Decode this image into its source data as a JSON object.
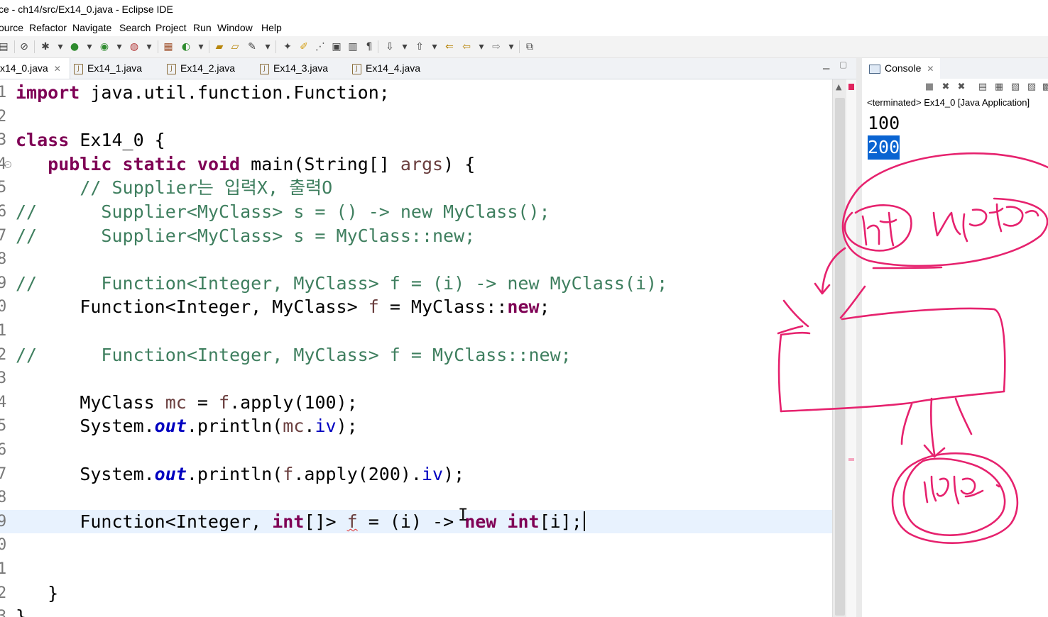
{
  "window": {
    "title": "ce - ch14/src/Ex14_0.java - Eclipse IDE"
  },
  "menu": [
    "ource",
    "Refactor",
    "Navigate",
    "Search",
    "Project",
    "Run",
    "Window",
    "Help"
  ],
  "editor": {
    "tabs": [
      {
        "label": "x14_0.java",
        "active": true,
        "closable": true
      },
      {
        "label": "Ex14_1.java"
      },
      {
        "label": "Ex14_2.java"
      },
      {
        "label": "Ex14_3.java"
      },
      {
        "label": "Ex14_4.java"
      }
    ],
    "line_numbers": [
      "1",
      "2",
      "3",
      "4",
      "5",
      "6",
      "7",
      "8",
      "9",
      "0",
      "1",
      "2",
      "3",
      "4",
      "5",
      "6",
      "7",
      "8",
      "9",
      "0",
      "1",
      "2",
      "3"
    ],
    "current_line_index": 18,
    "code": {
      "l1": {
        "kw": "import",
        "rest": " java.util.function.Function;"
      },
      "l3": {
        "kw": "class",
        "rest": " Ex14_0 {"
      },
      "l4": {
        "indent": "   ",
        "kw1": "public",
        "s1": " ",
        "kw2": "static",
        "s2": " ",
        "kw3": "void",
        "rest": " main(String[] ",
        "args": "args",
        "end": ") {"
      },
      "l5": {
        "indent": "      ",
        "comment": "// Supplier는 입력X, 출력O"
      },
      "l6": {
        "comment": "//      Supplier<MyClass> s = () -> new MyClass();"
      },
      "l7": {
        "comment": "//      Supplier<MyClass> s = MyClass::new;"
      },
      "l9": {
        "comment": "//      Function<Integer, MyClass> f = (i) -> new MyClass(i);"
      },
      "l10": {
        "indent": "      ",
        "a": "Function<Integer, MyClass> ",
        "f": "f",
        "b": " = MyClass::",
        "kw": "new",
        "end": ";"
      },
      "l12": {
        "comment": "//      Function<Integer, MyClass> f = MyClass::new;"
      },
      "l14": {
        "indent": "      ",
        "a": "MyClass ",
        "mc": "mc",
        "b": " = ",
        "f": "f",
        "c": ".apply(100);"
      },
      "l15": {
        "indent": "      ",
        "a": "System.",
        "out": "out",
        "b": ".println(",
        "mc": "mc",
        "c": ".",
        "iv": "iv",
        "d": ");"
      },
      "l17": {
        "indent": "      ",
        "a": "System.",
        "out": "out",
        "b": ".println(",
        "f": "f",
        "c": ".apply(200).",
        "iv": "iv",
        "d": ");"
      },
      "l19": {
        "indent": "      ",
        "a": "Function<Integer, ",
        "kw1": "int",
        "b": "[]> ",
        "f": "f",
        "c": " = (i) -> ",
        "kw2": "new",
        "s": " ",
        "kw3": "int",
        "d": "[i];"
      },
      "l22": {
        "indent": "   ",
        "text": "}"
      },
      "l23": {
        "text": "}"
      }
    }
  },
  "console": {
    "tab_label": "Console",
    "status": "<terminated> Ex14_0 [Java Application]",
    "output": [
      "100",
      "200"
    ],
    "selected_line": "200"
  },
  "annotation_color": "#e6226e"
}
